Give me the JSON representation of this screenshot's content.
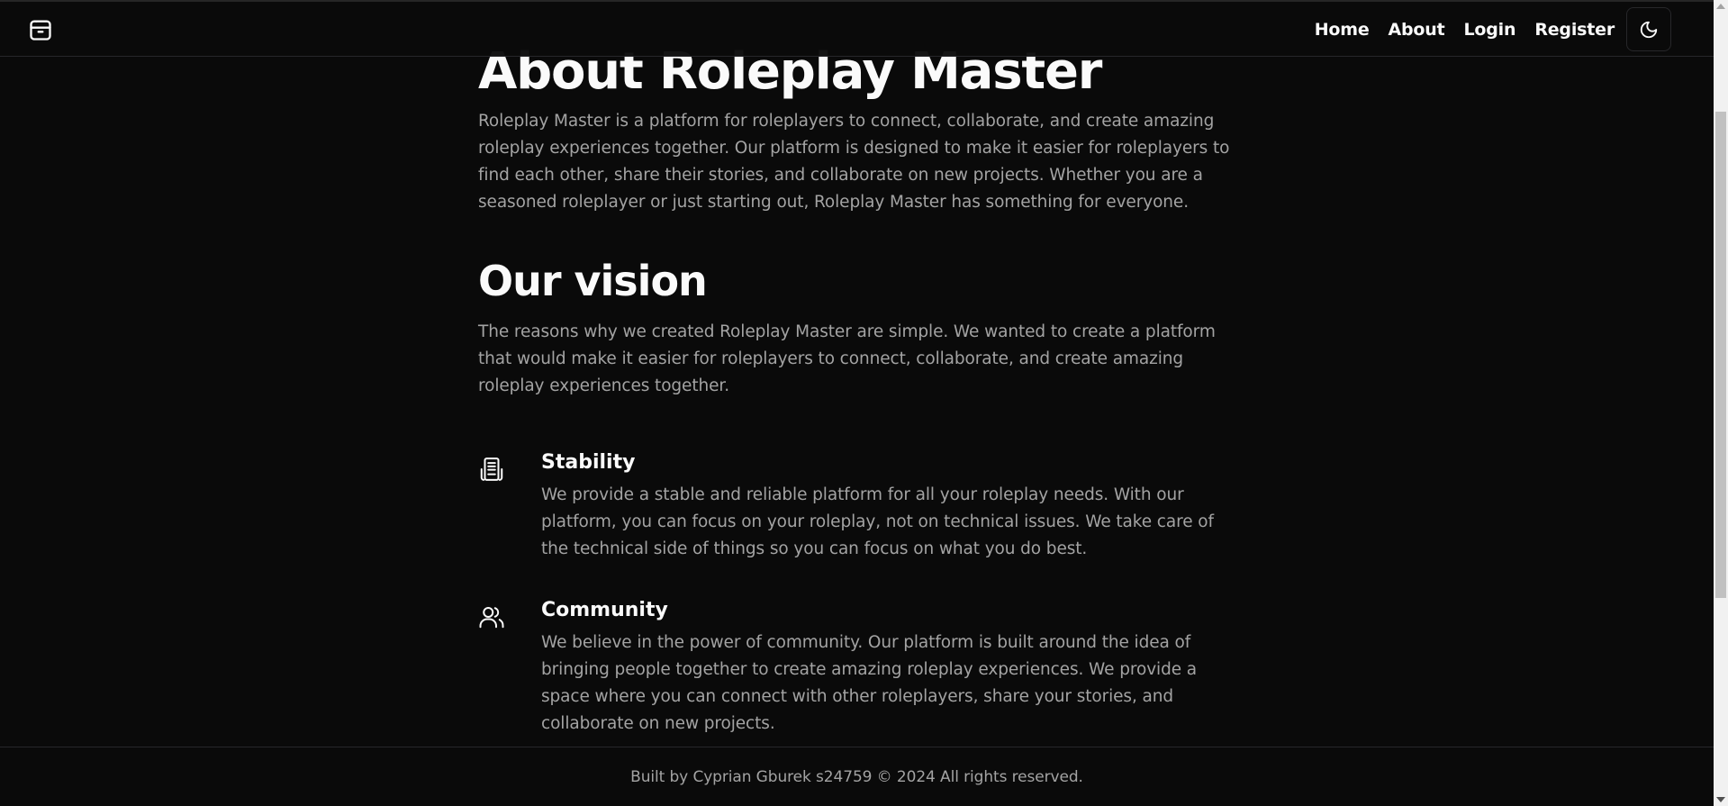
{
  "header": {
    "logo_icon": "package-icon",
    "nav": [
      {
        "label": "Home"
      },
      {
        "label": "About"
      },
      {
        "label": "Login"
      },
      {
        "label": "Register"
      }
    ],
    "theme_toggle_icon": "moon-icon"
  },
  "main": {
    "title": "About Roleplay Master",
    "intro": "Roleplay Master is a platform for roleplayers to connect, collaborate, and create amazing roleplay experiences together. Our platform is designed to make it easier for roleplayers to find each other, share their stories, and collaborate on new projects. Whether you are a seasoned roleplayer or just starting out, Roleplay Master has something for everyone.",
    "vision_title": "Our vision",
    "vision_text": "The reasons why we created Roleplay Master are simple. We wanted to create a platform that would make it easier for roleplayers to connect, collaborate, and create amazing roleplay experiences together.",
    "features": [
      {
        "icon": "server-icon",
        "title": "Stability",
        "text": "We provide a stable and reliable platform for all your roleplay needs. With our platform, you can focus on your roleplay, not on technical issues. We take care of the technical side of things so you can focus on what you do best."
      },
      {
        "icon": "users-icon",
        "title": "Community",
        "text": "We believe in the power of community. Our platform is built around the idea of bringing people together to create amazing roleplay experiences. We provide a space where you can connect with other roleplayers, share your stories, and collaborate on new projects."
      }
    ]
  },
  "footer": {
    "text": "Built by Cyprian Gburek s24759 © 2024 All rights reserved."
  },
  "colors": {
    "background": "#0a0a0a",
    "text": "#fafafa",
    "muted": "#a3a3a3",
    "border": "#27272a"
  }
}
